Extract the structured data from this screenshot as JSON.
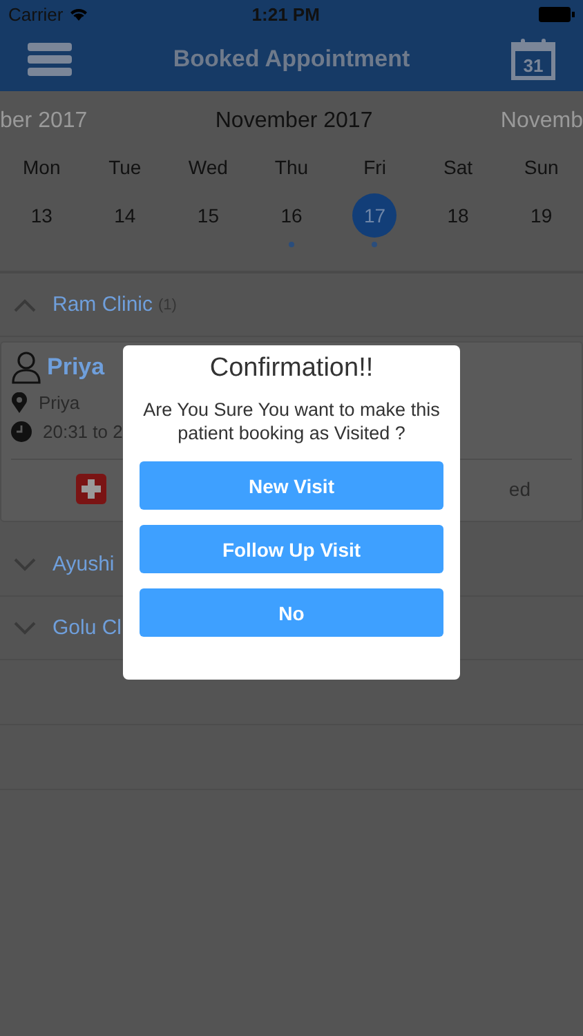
{
  "status_bar": {
    "carrier": "Carrier",
    "time": "1:21 PM"
  },
  "nav": {
    "title": "Booked Appointment",
    "calendar_day": "31"
  },
  "months": {
    "previous": "ber 2017",
    "current": "November 2017",
    "next": "Novemb"
  },
  "weekdays": [
    "Mon",
    "Tue",
    "Wed",
    "Thu",
    "Fri",
    "Sat",
    "Sun"
  ],
  "days": [
    {
      "label": "13",
      "selected": false,
      "has_booking": false
    },
    {
      "label": "14",
      "selected": false,
      "has_booking": false
    },
    {
      "label": "15",
      "selected": false,
      "has_booking": false
    },
    {
      "label": "16",
      "selected": false,
      "has_booking": true
    },
    {
      "label": "17",
      "selected": true,
      "has_booking": true
    },
    {
      "label": "18",
      "selected": false,
      "has_booking": false
    },
    {
      "label": "19",
      "selected": false,
      "has_booking": false
    }
  ],
  "clinics": [
    {
      "name": "Ram Clinic",
      "count": "(1)",
      "expanded": true,
      "booking": {
        "patient": "Priya",
        "location": "Priya",
        "time": "20:31 to 2",
        "action_right": "ed"
      }
    },
    {
      "name": "Ayushi",
      "expanded": false
    },
    {
      "name": "Golu Cl",
      "expanded": false
    }
  ],
  "dialog": {
    "title": "Confirmation!!",
    "message": "Are You Sure You want to make this patient booking as Visited ?",
    "buttons": [
      "New Visit",
      "Follow Up Visit",
      "No"
    ]
  }
}
